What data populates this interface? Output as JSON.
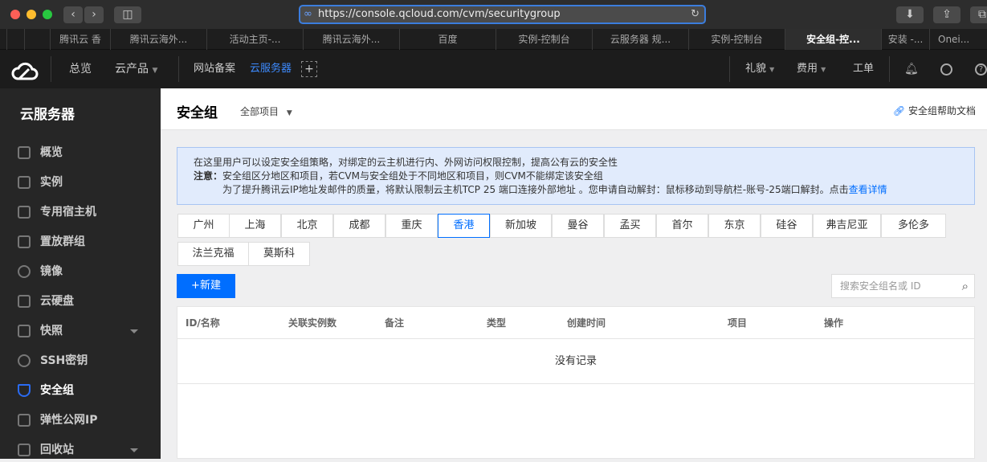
{
  "browser": {
    "url": "https://console.qcloud.com/cvm/securitygroup",
    "tabs": [
      "腾讯云 香",
      "腾讯云海外...",
      "活动主页-...",
      "腾讯云海外...",
      "百度",
      "实例-控制台",
      "云服务器 规...",
      "实例-控制台",
      "安全组-控...",
      "安装 -...",
      "Onei..."
    ]
  },
  "topnav": {
    "overview": "总览",
    "products": "云产品",
    "beian": "网站备案",
    "cvm": "云服务器",
    "gift": "礼貌",
    "billing": "费用",
    "ticket": "工单"
  },
  "sidebar": {
    "title": "云服务器",
    "items": [
      {
        "label": "概览"
      },
      {
        "label": "实例"
      },
      {
        "label": "专用宿主机"
      },
      {
        "label": "置放群组"
      },
      {
        "label": "镜像"
      },
      {
        "label": "云硬盘"
      },
      {
        "label": "快照"
      },
      {
        "label": "SSH密钥"
      },
      {
        "label": "安全组"
      },
      {
        "label": "弹性公网IP"
      },
      {
        "label": "回收站"
      }
    ]
  },
  "header": {
    "title": "安全组",
    "project": "全部项目",
    "help": "安全组帮助文档"
  },
  "notice": {
    "line1": "在这里用户可以设定安全组策略，对绑定的云主机进行内、外网访问权限控制，提高公有云的安全性",
    "note_label": "注意：",
    "line2": "安全组区分地区和项目，若CVM与安全组处于不同地区和项目，则CVM不能绑定该安全组",
    "line3": "为了提升腾讯云IP地址发邮件的质量，将默认限制云主机TCP 25 端口连接外部地址 。您申请自动解封：鼠标移动到导航栏-账号-25端口解封。点击",
    "link": "查看详情"
  },
  "regions": [
    "广州",
    "上海",
    "北京",
    "成都",
    "重庆",
    "香港",
    "新加坡",
    "曼谷",
    "孟买",
    "首尔",
    "东京",
    "硅谷",
    "弗吉尼亚",
    "多伦多",
    "法兰克福",
    "莫斯科"
  ],
  "selected_region": "香港",
  "toolbar": {
    "new": "+新建",
    "search_placeholder": "搜索安全组名或 ID"
  },
  "table": {
    "columns": [
      "ID/名称",
      "关联实例数",
      "备注",
      "类型",
      "创建时间",
      "项目",
      "操作"
    ],
    "empty": "没有记录"
  },
  "colors": {
    "accent": "#006eff",
    "sidebar": "#262626",
    "topnav": "#1c1c1c"
  }
}
